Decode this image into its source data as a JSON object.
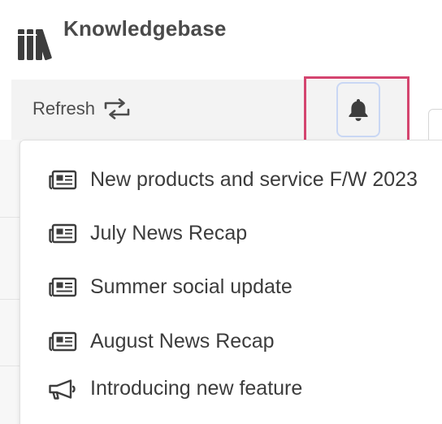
{
  "app": {
    "title": "Knowledgebase",
    "logo_icon": "books-icon"
  },
  "toolbar": {
    "refresh_label": "Refresh",
    "refresh_icon": "repeat-icon",
    "notification_icon": "bell-icon"
  },
  "colors": {
    "highlight": "#d4456f",
    "button_outline": "#c9d7f4",
    "text": "#3c3c3c",
    "icon": "#3d3d3d"
  },
  "notifications": {
    "items": [
      {
        "title": "New products and service F/W 2023",
        "icon": "newspaper-icon"
      },
      {
        "title": "July News Recap",
        "icon": "newspaper-icon"
      },
      {
        "title": "Summer social update",
        "icon": "newspaper-icon"
      },
      {
        "title": "August News Recap",
        "icon": "newspaper-icon"
      },
      {
        "title": "Introducing new feature",
        "icon": "megaphone-icon"
      }
    ]
  }
}
